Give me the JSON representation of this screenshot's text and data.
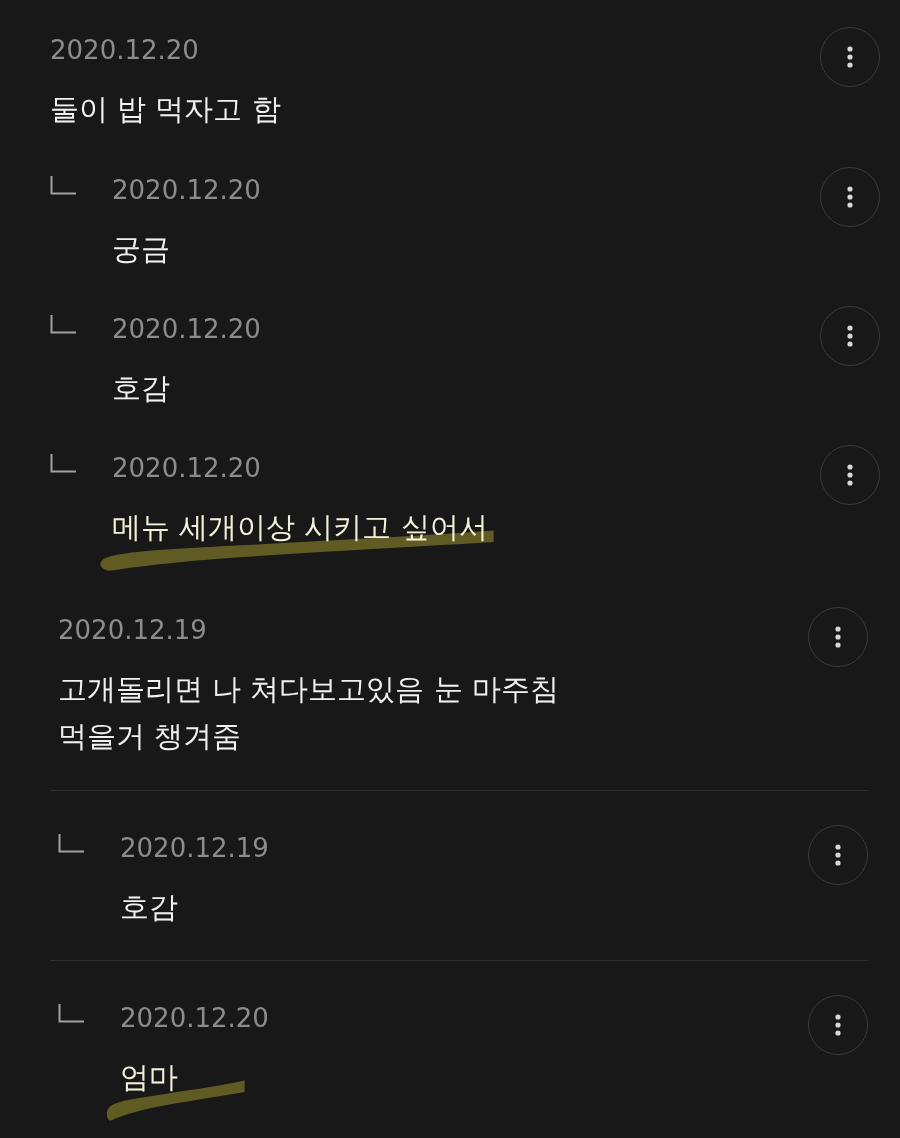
{
  "comments": [
    {
      "date": "2020.12.20",
      "text": "둘이 밥 먹자고 함",
      "dividers": false,
      "replies": [
        {
          "date": "2020.12.20",
          "text": "궁금",
          "highlighted": false
        },
        {
          "date": "2020.12.20",
          "text": "호감",
          "highlighted": false
        },
        {
          "date": "2020.12.20",
          "text": "메뉴 세개이상 시키고 싶어서",
          "highlighted": true
        }
      ]
    },
    {
      "date": "2020.12.19",
      "text": "고개돌리면 나 쳐다보고있음 눈 마주침\n먹을거 챙겨줌",
      "dividers": true,
      "replies": [
        {
          "date": "2020.12.19",
          "text": "호감",
          "highlighted": false
        },
        {
          "date": "2020.12.20",
          "text": "엄마",
          "highlighted": true
        }
      ]
    }
  ]
}
